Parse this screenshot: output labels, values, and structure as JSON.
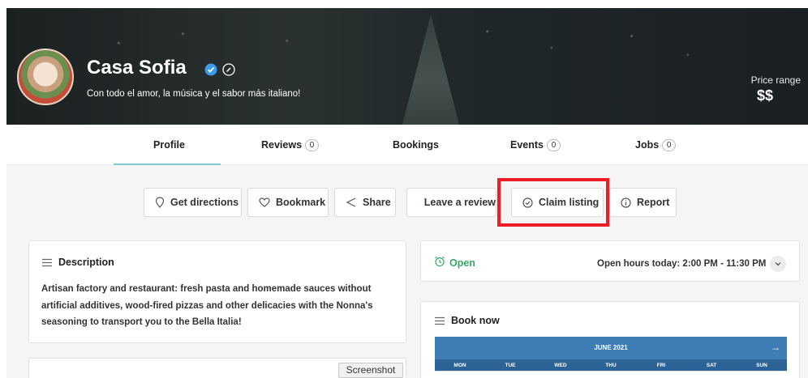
{
  "hero": {
    "title": "Casa Sofia",
    "subtitle": "Con todo el amor, la música y el sabor más italiano!",
    "price_label": "Price range",
    "price_value": "$$"
  },
  "tabs": [
    {
      "label": "Profile",
      "count": null,
      "active": true
    },
    {
      "label": "Reviews",
      "count": "0"
    },
    {
      "label": "Bookings",
      "count": null
    },
    {
      "label": "Events",
      "count": "0"
    },
    {
      "label": "Jobs",
      "count": "0"
    }
  ],
  "actions": [
    {
      "label": "Get directions",
      "icon": "location-pin-icon"
    },
    {
      "label": "Bookmark",
      "icon": "heart-icon"
    },
    {
      "label": "Share",
      "icon": "share-icon"
    },
    {
      "label": "Leave a review",
      "icon": "comment-icon"
    },
    {
      "label": "Claim listing",
      "icon": "shield-check-icon",
      "highlighted": true
    },
    {
      "label": "Report",
      "icon": "info-icon"
    }
  ],
  "description": {
    "title": "Description",
    "lines": [
      "Artisan factory and restaurant: fresh pasta and homemade sauces without",
      "artificial additives, wood-fired pizzas and other delicacies with the Nonna's",
      "seasoning to transport you to the Bella Italia!"
    ]
  },
  "status": {
    "open_label": "Open",
    "hours_text": "Open hours today: 2:00 PM - 11:30 PM"
  },
  "book_now": {
    "title": "Book now",
    "month": "JUNE 2021",
    "weekdays": [
      "MON",
      "TUE",
      "WED",
      "THU",
      "FRI",
      "SAT",
      "SUN"
    ]
  },
  "tooltip": {
    "label": "Screenshot"
  },
  "colors": {
    "accent": "#7ccbd2",
    "open_green": "#3aa769",
    "calendar_blue": "#3f7db7",
    "highlight_red": "#ee1c24"
  }
}
